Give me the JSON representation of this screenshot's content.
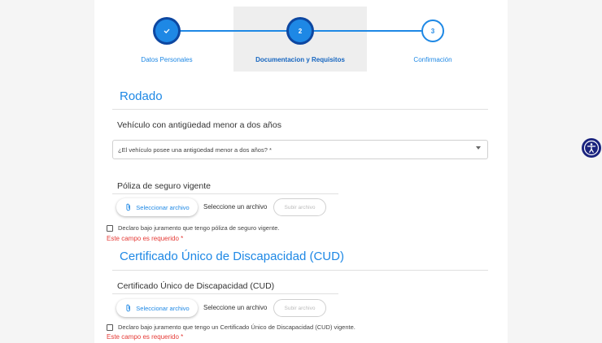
{
  "stepper": {
    "steps": [
      {
        "label": "Datos Personales",
        "icon": "check-icon"
      },
      {
        "label": "Documentacion y Requisitos",
        "number": "2"
      },
      {
        "label": "Confirmación",
        "number": "3"
      }
    ]
  },
  "rodado": {
    "title": "Rodado",
    "vehicle_heading": "Vehículo con antigüedad menor a dos años",
    "vehicle_select_label": "¿El vehículo posee una antigüedad menor a dos años? *",
    "policy_heading": "Póliza de seguro vigente",
    "select_file_label": "Seleccionar archivo",
    "file_status": "Seleccione un archivo",
    "upload_label": "Subir archivo",
    "declaration": "Declaro bajo juramento que tengo póliza de seguro vigente.",
    "error": "Este campo es requerido *"
  },
  "cud": {
    "title": "Certificado Único de Discapacidad (CUD)",
    "heading": "Certificado Único de Discapacidad (CUD)",
    "select_file_label": "Seleccionar archivo",
    "file_status": "Seleccione un archivo",
    "upload_label": "Subir archivo",
    "declaration": "Declaro bajo juramento que tengo un Certificado Único de Discapacidad (CUD) vigente.",
    "error": "Este campo es requerido *"
  },
  "colors": {
    "accent": "#1e88e5",
    "error": "#e53935"
  },
  "accessibility": {
    "icon": "accessibility-icon"
  }
}
